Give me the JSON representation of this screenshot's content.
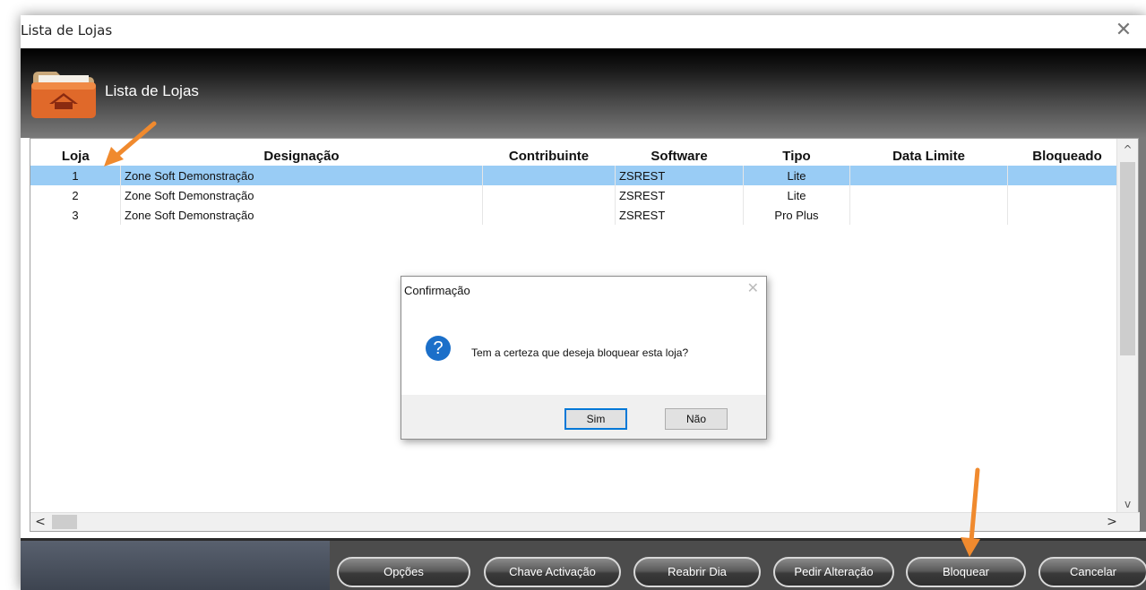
{
  "window": {
    "title": "Lista de Lojas",
    "close_glyph": "✕"
  },
  "header": {
    "title": "Lista de Lojas",
    "icon": "folder-home-icon"
  },
  "table": {
    "columns": [
      "Loja",
      "Designação",
      "Contribuinte",
      "Software",
      "Tipo",
      "Data Limite",
      "Bloqueado"
    ],
    "rows": [
      [
        "1",
        "Zone Soft Demonstração",
        "",
        "ZSREST",
        "Lite",
        "",
        ""
      ],
      [
        "2",
        "Zone Soft Demonstração",
        "",
        "ZSREST",
        "Lite",
        "",
        ""
      ],
      [
        "3",
        "Zone Soft Demonstração",
        "",
        "ZSREST",
        "Pro Plus",
        "",
        ""
      ]
    ],
    "selected_row": 0
  },
  "scroll": {
    "up": "^",
    "down": "v",
    "left": "<",
    "right": ">"
  },
  "footer": {
    "buttons": [
      "Opções",
      "Chave Activação",
      "Reabrir Dia",
      "Pedir Alteração",
      "Bloquear",
      "Cancelar"
    ]
  },
  "dialog": {
    "title": "Confirmação",
    "close_glyph": "✕",
    "icon": "question-icon",
    "icon_glyph": "?",
    "message": "Tem a certeza que deseja bloquear esta loja?",
    "yes_label": "Sim",
    "no_label": "Não"
  },
  "colors": {
    "selection": "#99ccf5",
    "arrow": "#f08a2e",
    "accent": "#0078d7"
  }
}
